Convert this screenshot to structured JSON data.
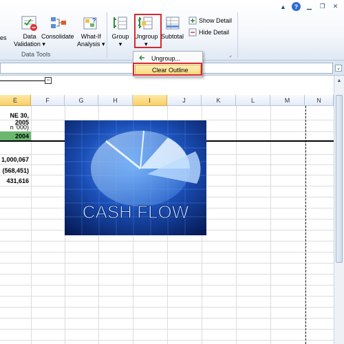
{
  "ribbon": {
    "data_validation_label_1": "Data",
    "data_validation_label_2": "Validation",
    "prefix_fragment": "es",
    "consolidate_label": "Consolidate",
    "whatif_label_1": "What-If",
    "whatif_label_2": "Analysis",
    "group_label": "Group",
    "ungroup_label": "Ungroup",
    "subtotal_label": "Subtotal",
    "show_detail_label": "Show Detail",
    "hide_detail_label": "Hide Detail",
    "data_tools_group": "Data Tools"
  },
  "dropdown": {
    "ungroup_item": "Ungroup...",
    "clear_outline_item": "Clear Outline"
  },
  "columns": [
    "E",
    "F",
    "G",
    "H",
    "I",
    "J",
    "K",
    "L",
    "M",
    "N"
  ],
  "cells": {
    "e_row1": "NE 30, 2005",
    "e_row2": "n '000)",
    "e_row3": "2004",
    "e_row5": "1,000,067",
    "e_row6": "(568,451)",
    "e_row7": "431,616"
  },
  "picture": {
    "caption": "CASH FLOW"
  },
  "colors": {
    "highlight_red": "#d7272f",
    "green_cell": "#6ab870",
    "selected_column": "#f8cf6b"
  }
}
